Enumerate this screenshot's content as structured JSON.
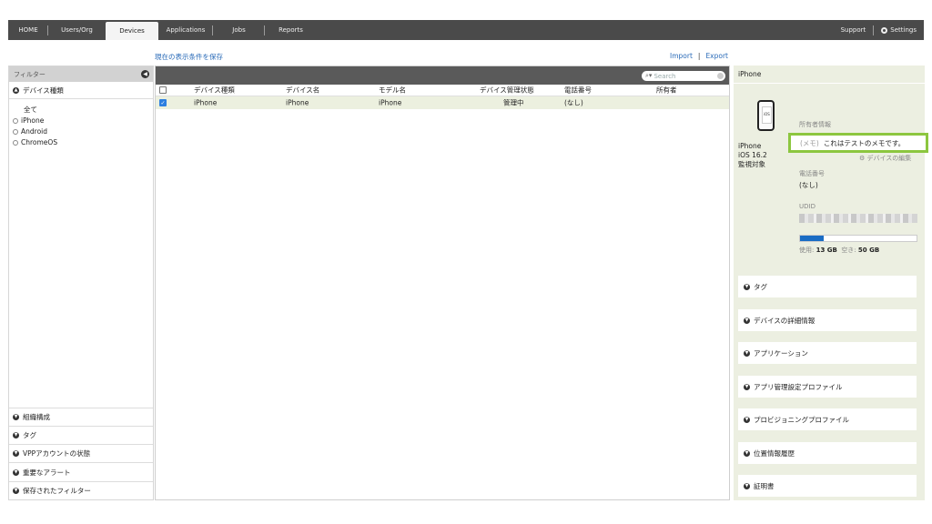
{
  "nav": {
    "tabs": [
      {
        "label": "HOME"
      },
      {
        "label": "Users/Org"
      },
      {
        "label": "Devices"
      },
      {
        "label": "Applications"
      },
      {
        "label": "Jobs"
      },
      {
        "label": "Reports"
      }
    ],
    "support_label": "Support",
    "settings_label": "Settings"
  },
  "toolbar": {
    "save_filter_label": "現在の表示条件を保存",
    "import_label": "Import",
    "export_label": "Export",
    "separator": "|"
  },
  "filter": {
    "title": "フィルター",
    "device_type_section": "デバイス種類",
    "options": [
      "全て",
      "iPhone",
      "Android",
      "ChromeOS"
    ],
    "bottom_sections": [
      "組織構成",
      "タグ",
      "VPPアカウントの状態",
      "重要なアラート",
      "保存されたフィルター"
    ]
  },
  "table": {
    "search_placeholder": "Search",
    "columns": [
      "デバイス種類",
      "デバイス名",
      "モデル名",
      "デバイス管理状態",
      "電話番号",
      "所有者"
    ],
    "rows": [
      {
        "type": "iPhone",
        "name": "iPhone",
        "model": "iPhone",
        "status": "管理中",
        "phone": "(なし)",
        "owner": "",
        "checked": true
      }
    ]
  },
  "detail": {
    "title": "iPhone",
    "icon_label": "iOS",
    "device_name": "iPhone",
    "os_version": "iOS 16.2",
    "supervised": "監視対象",
    "owner_info_label": "所有者情報",
    "memo_tag": "(メモ)",
    "memo_text": "これはテストのメモです。",
    "edit_label": "⚙ デバイスの編集",
    "phone_label": "電話番号",
    "phone_value": "(なし)",
    "udid_label": "UDID",
    "storage": {
      "used_label": "使用:",
      "used": "13 GB",
      "free_label": "空き:",
      "free": "50 GB",
      "used_fraction": 0.2
    },
    "accordions": [
      "タグ",
      "デバイスの詳細情報",
      "アプリケーション",
      "アプリ管理設定プロファイル",
      "プロビジョニングプロファイル",
      "位置情報履歴",
      "証明書"
    ]
  },
  "colors": {
    "accent": "#2a6bb8",
    "highlight": "#8cc63f",
    "selected_row": "#ecf0df",
    "storage_fill": "#1a6cc4"
  }
}
